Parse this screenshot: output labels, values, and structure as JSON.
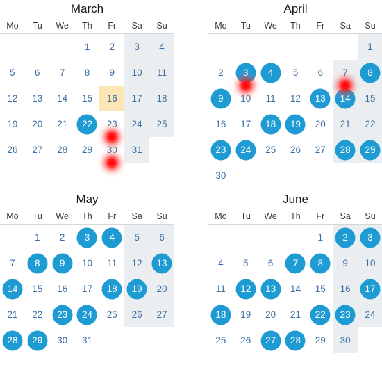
{
  "colors": {
    "selected_circle": "#1f9bd4",
    "today_highlight": "#fbe6b4",
    "weekend_shade": "#ebeef0",
    "day_text": "#3b6ea5",
    "selected_text": "#ffffff",
    "month_title": "#1a1a1a",
    "weekday_header": "#3a3a3a",
    "header_rule": "#d6d6d6",
    "glow_marker": "#ff0000"
  },
  "weekday_headers": [
    "Mo",
    "Tu",
    "We",
    "Th",
    "Fr",
    "Sa",
    "Su"
  ],
  "months": [
    {
      "name": "March",
      "position": "top-left",
      "start_weekday_index": 3,
      "num_days": 31,
      "selected_days": [
        22
      ],
      "today": 16,
      "glow_days": [
        23,
        30
      ],
      "weeks": [
        [
          null,
          null,
          null,
          1,
          2,
          3,
          4
        ],
        [
          5,
          6,
          7,
          8,
          9,
          10,
          11
        ],
        [
          12,
          13,
          14,
          15,
          16,
          17,
          18
        ],
        [
          19,
          20,
          21,
          22,
          23,
          24,
          25
        ],
        [
          26,
          27,
          28,
          29,
          30,
          31,
          null
        ]
      ]
    },
    {
      "name": "April",
      "position": "top-right",
      "start_weekday_index": 6,
      "num_days": 30,
      "selected_days": [
        3,
        4,
        8,
        9,
        13,
        14,
        18,
        19,
        23,
        24,
        28,
        29
      ],
      "today": null,
      "glow_days": [
        3,
        7
      ],
      "weeks": [
        [
          null,
          null,
          null,
          null,
          null,
          null,
          1
        ],
        [
          2,
          3,
          4,
          5,
          6,
          7,
          8
        ],
        [
          9,
          10,
          11,
          12,
          13,
          14,
          15
        ],
        [
          16,
          17,
          18,
          19,
          20,
          21,
          22
        ],
        [
          23,
          24,
          25,
          26,
          27,
          28,
          29
        ],
        [
          30,
          null,
          null,
          null,
          null,
          null,
          null
        ]
      ]
    },
    {
      "name": "May",
      "position": "bottom-left",
      "start_weekday_index": 1,
      "num_days": 31,
      "selected_days": [
        3,
        4,
        8,
        9,
        13,
        14,
        18,
        19,
        23,
        24,
        28,
        29
      ],
      "today": null,
      "glow_days": [],
      "weeks": [
        [
          null,
          1,
          2,
          3,
          4,
          5,
          6
        ],
        [
          7,
          8,
          9,
          10,
          11,
          12,
          13
        ],
        [
          14,
          15,
          16,
          17,
          18,
          19,
          20
        ],
        [
          21,
          22,
          23,
          24,
          25,
          26,
          27
        ],
        [
          28,
          29,
          30,
          31,
          null,
          null,
          null
        ]
      ]
    },
    {
      "name": "June",
      "position": "bottom-right",
      "start_weekday_index": 4,
      "num_days": 30,
      "selected_days": [
        2,
        3,
        7,
        8,
        12,
        13,
        17,
        18,
        22,
        23,
        27,
        28
      ],
      "today": null,
      "glow_days": [],
      "weeks": [
        [
          null,
          null,
          null,
          null,
          1,
          2,
          3
        ],
        [
          4,
          5,
          6,
          7,
          8,
          9,
          10
        ],
        [
          11,
          12,
          13,
          14,
          15,
          16,
          17
        ],
        [
          18,
          19,
          20,
          21,
          22,
          23,
          24
        ],
        [
          25,
          26,
          27,
          28,
          29,
          30,
          null
        ]
      ]
    }
  ]
}
